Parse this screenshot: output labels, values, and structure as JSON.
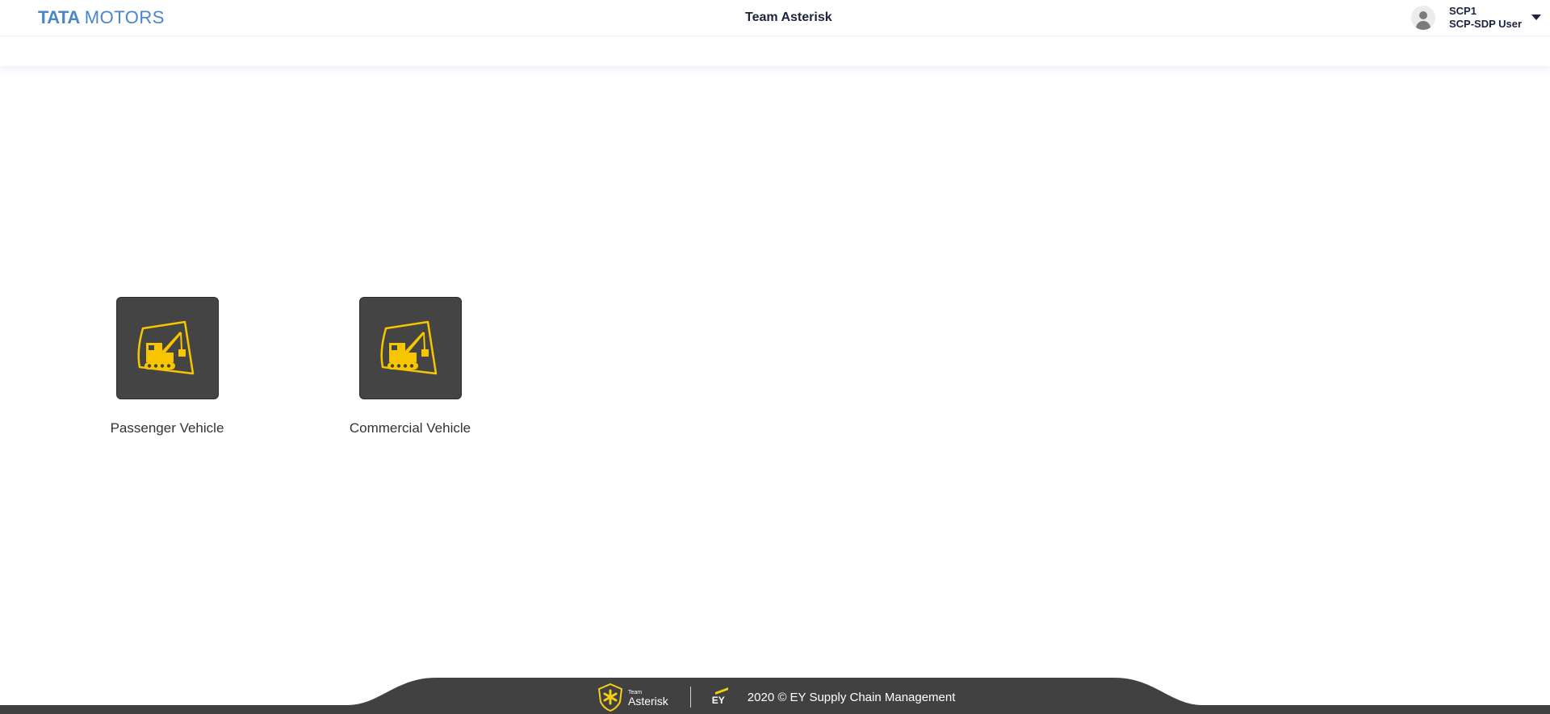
{
  "brand": {
    "logo_word1": "TATA",
    "logo_word2": "MOTORS",
    "color": "#4a86c8"
  },
  "header": {
    "title": "Team Asterisk"
  },
  "user": {
    "name": "SCP1",
    "role": "SCP-SDP User",
    "avatar_icon": "user-avatar-icon",
    "menu_icon": "caret-down-icon"
  },
  "tiles": [
    {
      "label": "Passenger Vehicle",
      "icon": "crane-truck-icon"
    },
    {
      "label": "Commercial Vehicle",
      "icon": "crane-truck-icon"
    }
  ],
  "footer": {
    "team_small": "Team",
    "team_name": "Asterisk",
    "ey": "EY",
    "copyright": "2020 © EY Supply Chain Management",
    "background_color": "#414141",
    "accent_color": "#f3cf14"
  }
}
